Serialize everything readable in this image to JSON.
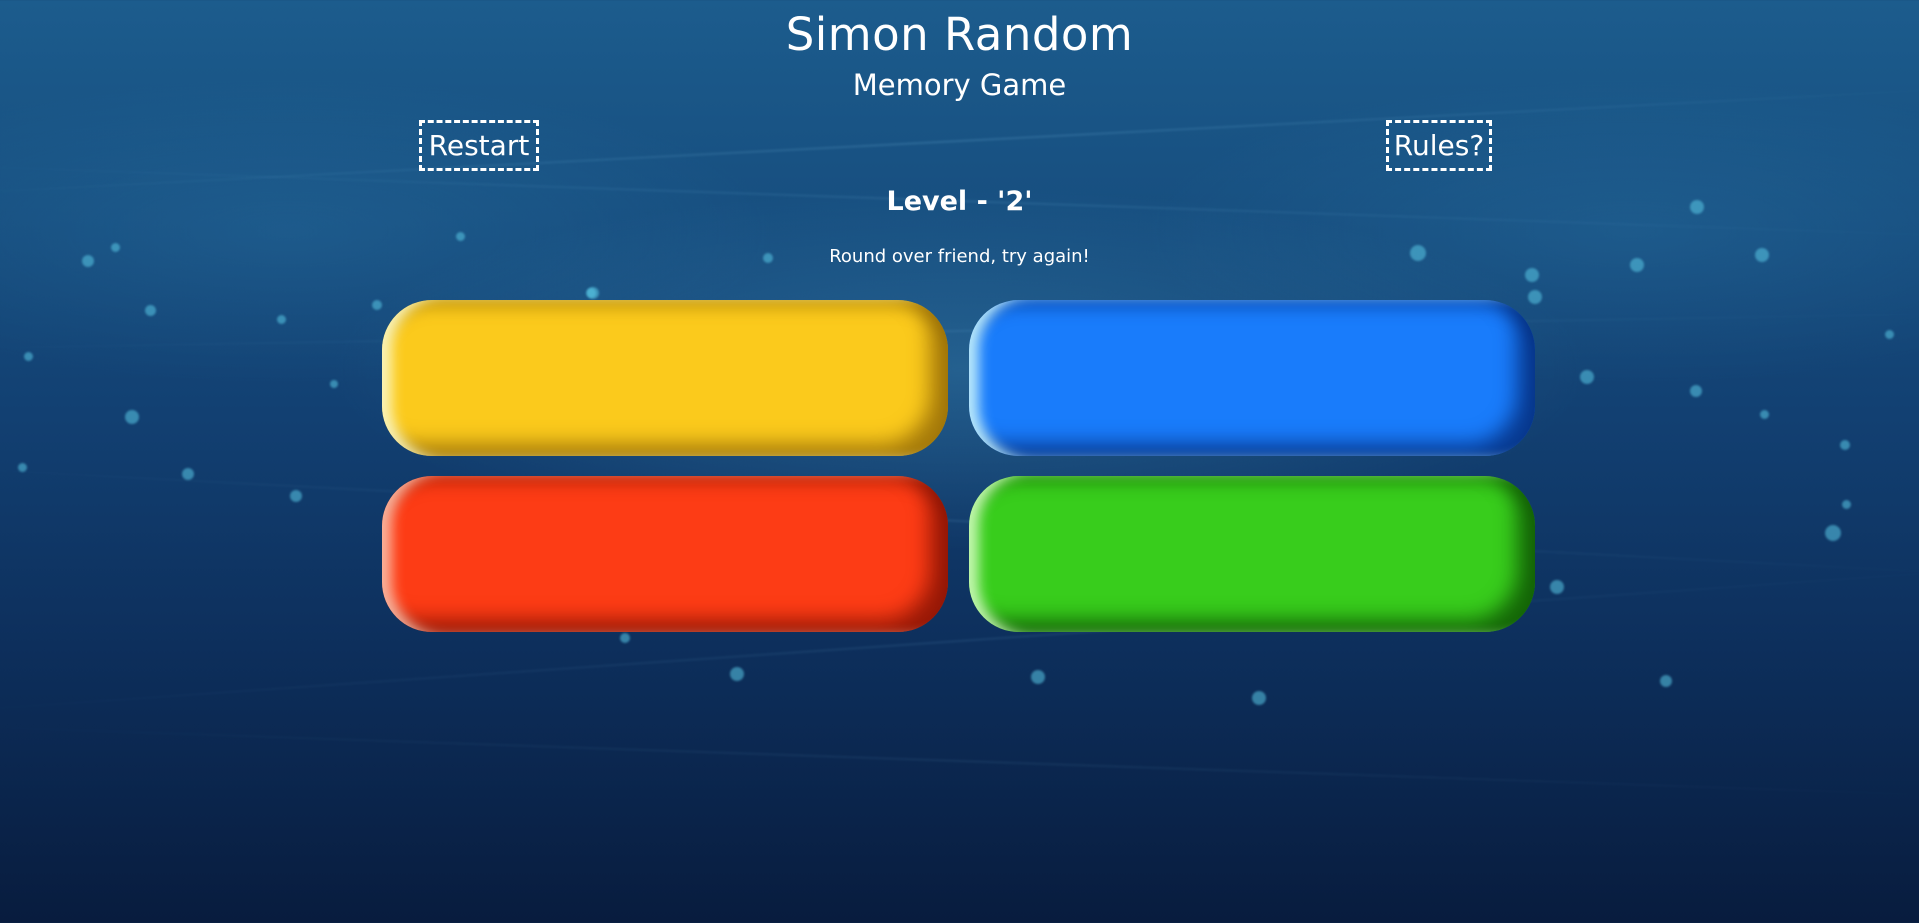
{
  "header": {
    "title": "Simon Random",
    "subtitle": "Memory Game"
  },
  "controls": {
    "restart_label": "Restart",
    "rules_label": "Rules?"
  },
  "status": {
    "level_text": "Level - '2'",
    "message": "Round over friend, try again!"
  },
  "pads": [
    {
      "name": "yellow",
      "color": "#fbca1c"
    },
    {
      "name": "blue",
      "color": "#197cfb"
    },
    {
      "name": "red",
      "color": "#fd3c15"
    },
    {
      "name": "green",
      "color": "#38cd1c"
    }
  ],
  "theme": {
    "background": "#124072",
    "text": "#ffffff"
  }
}
